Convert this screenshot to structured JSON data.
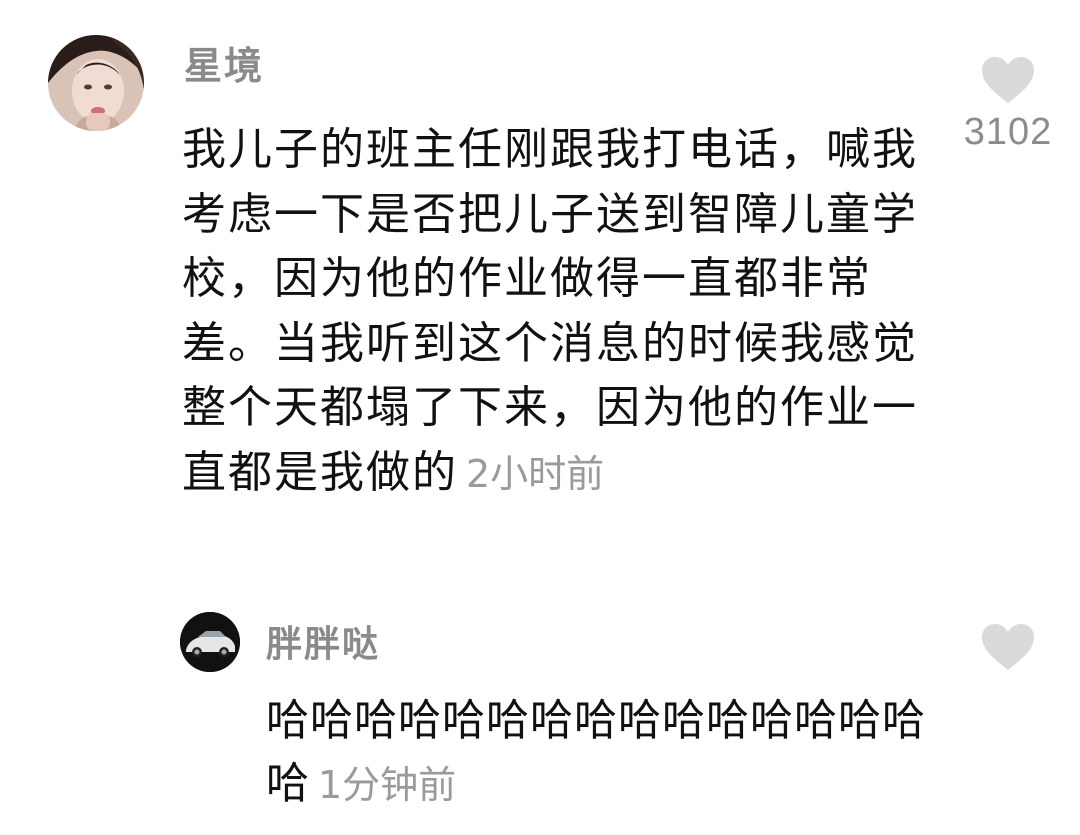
{
  "comment": {
    "username": "星境",
    "body": "我儿子的班主任刚跟我打电话，喊我考虑一下是否把儿子送到智障儿童学校，因为他的作业做得一直都非常差。当我听到这个消息的时候我感觉整个天都塌了下来，因为他的作业一直都是我做的",
    "time": "2小时前",
    "likes": "3102",
    "like_icon": "heart-icon",
    "avatar": "avatar-woman-photo"
  },
  "reply": {
    "username": "胖胖哒",
    "body": "哈哈哈哈哈哈哈哈哈哈哈哈哈哈哈哈",
    "time": "1分钟前",
    "like_icon": "heart-icon",
    "avatar": "avatar-car-photo"
  },
  "colors": {
    "username": "#8a8a8a",
    "timestamp": "#9a9a9a",
    "heart": "#dadada",
    "text": "#111111"
  }
}
